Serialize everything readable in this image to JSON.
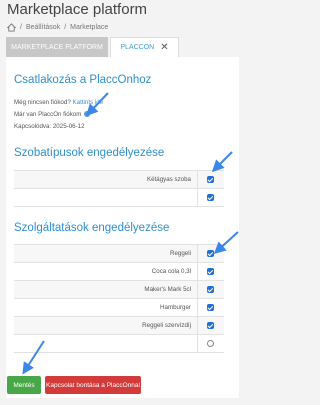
{
  "header": {
    "title": "Marketplace platform"
  },
  "breadcrumb": {
    "items": [
      "Beállítások",
      "Marketplace"
    ]
  },
  "tabs": [
    {
      "label": "MARKETPLACE PLATFORM"
    },
    {
      "label": "PLACCON"
    }
  ],
  "connect": {
    "heading": "Csatlakozás a PlaccOnhoz",
    "no_account_text": "Még nincsen fiókod?",
    "no_account_link": "Kattints ide",
    "has_account_text": "Már van PlaccOn fiókom",
    "connected_since": "Kapcsolódva: 2025-06-12"
  },
  "room_types": {
    "heading": "Szobatípusok engedélyezése",
    "rows": [
      {
        "label": "Kétágyas szoba",
        "checked": true
      },
      {
        "label": "",
        "checked": true
      }
    ]
  },
  "services": {
    "heading": "Szolgáltatások engedélyezése",
    "rows": [
      {
        "label": "Reggeli",
        "checked": true
      },
      {
        "label": "Coca cola 0,3l",
        "checked": true
      },
      {
        "label": "Maker's Mark 5cl",
        "checked": true
      },
      {
        "label": "Hamburger",
        "checked": true
      },
      {
        "label": "Reggeli szervízdíj",
        "checked": true
      },
      {
        "label": "",
        "checked": false
      }
    ]
  },
  "buttons": {
    "save": "Mentés",
    "disconnect": "Kapcsolat bontása a PlaccOnnal"
  },
  "colors": {
    "accent": "#2f8fd0",
    "checkbox": "#1f6fd8",
    "save_button": "#48a848",
    "disconnect_button": "#d33b3b",
    "annotation_arrow": "#3b86e6"
  }
}
